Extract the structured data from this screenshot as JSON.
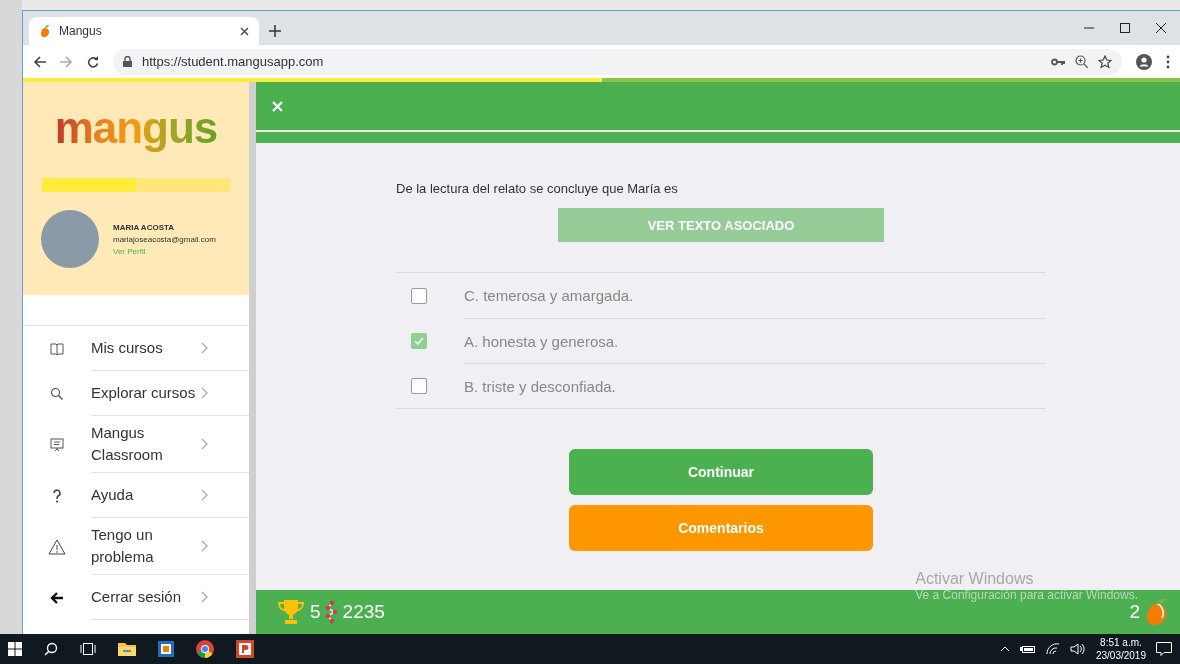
{
  "browser": {
    "tab_title": "Mangus",
    "url": "https://student.mangusapp.com",
    "page_load": {
      "level": 0.5
    }
  },
  "sidebar": {
    "logo": "mangus",
    "progress": {
      "level": 0.5
    },
    "user": {
      "name": "MARIA ACOSTA",
      "email": "mariajoseacosta@gmail.com",
      "profile_link": "Ver Perfil"
    },
    "menu": [
      {
        "label": "Mis cursos",
        "kind": "courses"
      },
      {
        "label": "Explorar cursos",
        "kind": "explore"
      },
      {
        "label": "Mangus Classroom",
        "kind": "classroom"
      },
      {
        "label": "Ayuda",
        "kind": "help"
      },
      {
        "label": "Tengo un problema",
        "kind": "problem"
      },
      {
        "label": "Cerrar sesión",
        "kind": "logout"
      }
    ]
  },
  "question": {
    "prompt": "De la lectura del relato se concluye que María es",
    "associated_text_button": "VER TEXTO ASOCIADO",
    "options": [
      {
        "label": "C. temerosa y amargada.",
        "checked": false
      },
      {
        "label": "A. honesta y generosa.",
        "checked": true
      },
      {
        "label": "B. triste y desconfiada.",
        "checked": false
      }
    ],
    "buttons": [
      {
        "label": "Continuar",
        "kind": "primary"
      },
      {
        "label": "Comentarios",
        "kind": "secondary"
      }
    ]
  },
  "footer": {
    "trophies": "5",
    "points": "2235",
    "mangos": "2"
  },
  "activation_notice": {
    "title": "Activar Windows",
    "subtitle": "Ve a Configuración para activar Windows."
  },
  "taskbar": {
    "time": "8:51 a.m.",
    "date": "23/03/2019"
  }
}
